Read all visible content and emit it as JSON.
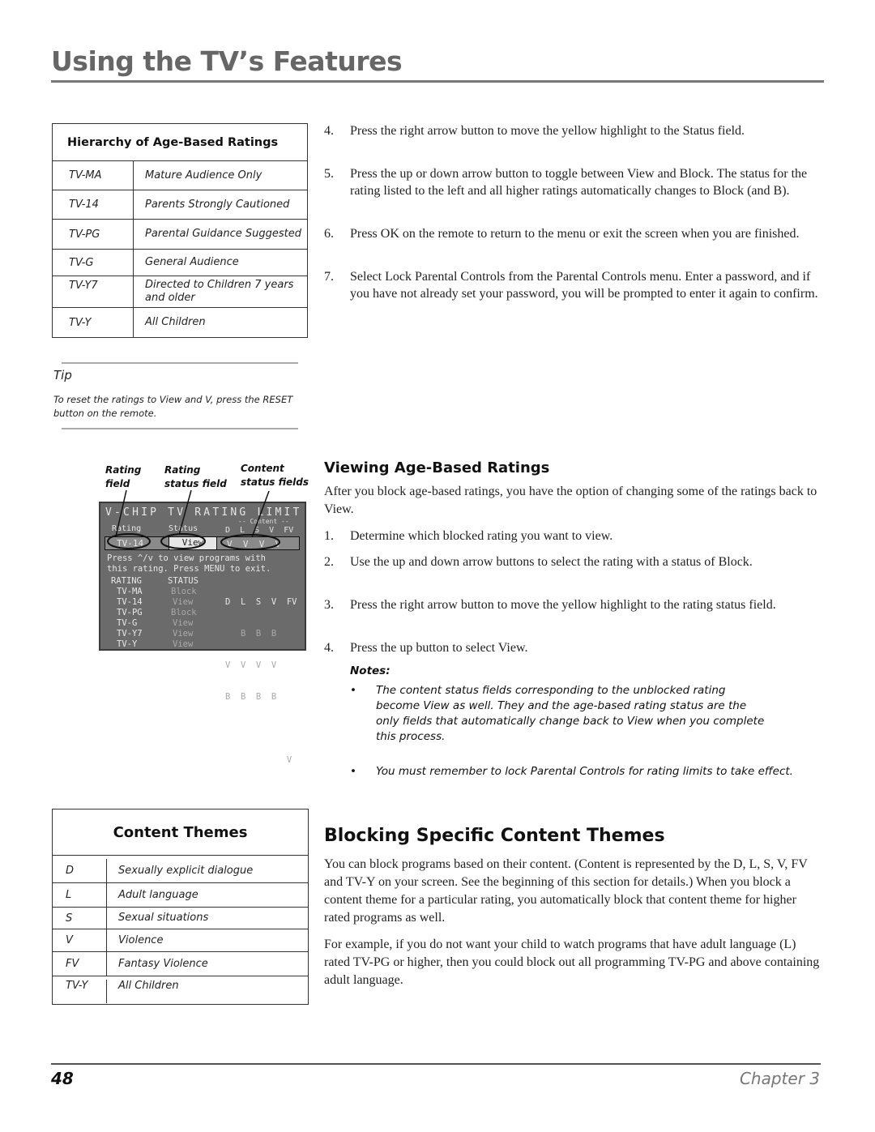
{
  "header": {
    "title": "Using the TV’s Features"
  },
  "ratings_table": {
    "title": "Hierarchy of Age-Based Ratings",
    "rows": [
      {
        "code": "TV-MA",
        "desc": "Mature Audience Only"
      },
      {
        "code": "TV-14",
        "desc": "Parents Strongly Cautioned"
      },
      {
        "code": "TV-PG",
        "desc": "Parental Guidance Suggested"
      },
      {
        "code": "TV-G",
        "desc": "General Audience"
      },
      {
        "code": "TV-Y7",
        "desc": "Directed to Children 7 years and older"
      },
      {
        "code": "TV-Y",
        "desc": "All Children"
      }
    ]
  },
  "tip": {
    "label": "Tip",
    "text": "To reset the ratings to View and V, press the RESET button on the remote."
  },
  "diagram": {
    "callouts": {
      "rating_field": "Rating field",
      "rating_status_field": "Rating status field",
      "content_status_fields": "Content status fields"
    },
    "screen": {
      "title": "V-CHIP TV RATING LIMIT",
      "content_label": "-- Content --",
      "col_rating": "Rating",
      "col_status": "Status",
      "content_cols": "D  L  S  V  FV",
      "selected_rating": "TV-14",
      "selected_status": "View",
      "selected_content": "V  V  V  V",
      "help_line1": "Press ^/v to view programs with",
      "help_line2": "this rating. Press MENU to exit.",
      "list_header": {
        "rating": "RATING",
        "status": "STATUS",
        "content": "D  L  S  V  FV"
      },
      "list_rows": [
        {
          "rating": "TV-MA",
          "status": "Block",
          "content": "   B  B  B"
        },
        {
          "rating": "TV-14",
          "status": "View",
          "content": "V  V  V  V"
        },
        {
          "rating": "TV-PG",
          "status": "Block",
          "content": "B  B  B  B"
        },
        {
          "rating": "TV-G",
          "status": "View",
          "content": ""
        },
        {
          "rating": "TV-Y7",
          "status": "View",
          "content": "            V"
        },
        {
          "rating": "TV-Y",
          "status": "View",
          "content": ""
        }
      ]
    }
  },
  "steps_top": [
    {
      "num": "4.",
      "text": "Press the right arrow button to move the yellow highlight to the Status field."
    },
    {
      "num": "5.",
      "text": "Press the up or down arrow button to toggle between View and Block. The status for the rating listed to the left and all higher ratings automatically changes to Block (and B)."
    },
    {
      "num": "6.",
      "text": "Press OK on the remote to return to the menu or exit the screen when you are finished."
    },
    {
      "num": "7.",
      "text": "Select Lock Parental Controls from the Parental Controls menu. Enter a password, and if you have not already set your password, you will be prompted to enter it again to confirm."
    }
  ],
  "viewing": {
    "heading": "Viewing Age-Based Ratings",
    "intro": "After you block age-based ratings, you have the option of changing some of the ratings back to View.",
    "steps": [
      {
        "num": "1.",
        "text": "Determine which blocked rating you want to view."
      },
      {
        "num": "2.",
        "text": "Use the up and down arrow buttons to select the rating with a status of Block."
      },
      {
        "num": "3.",
        "text": "Press the right arrow button to move the yellow highlight to the rating status field."
      },
      {
        "num": "4.",
        "text": "Press the up button to select View."
      }
    ],
    "notes_label": "Notes:",
    "notes": [
      "The content status fields corresponding to the unblocked rating become View as well. They and the age-based rating status are the only fields that automatically change back to View when you complete this process.",
      "You must remember to lock Parental Controls for rating limits to take effect."
    ]
  },
  "themes_table": {
    "title": "Content Themes",
    "rows": [
      {
        "code": "D",
        "desc": "Sexually explicit dialogue"
      },
      {
        "code": "L",
        "desc": "Adult language"
      },
      {
        "code": "S",
        "desc": "Sexual situations"
      },
      {
        "code": "V",
        "desc": "Violence"
      },
      {
        "code": "FV",
        "desc": "Fantasy Violence"
      },
      {
        "code": "TV-Y",
        "desc": "All Children"
      }
    ]
  },
  "blocking": {
    "heading": "Blocking Specific Content Themes",
    "para1": "You can block programs based on their content. (Content is represented by the D, L, S, V, FV and TV-Y on your screen. See the beginning of this section for details.) When you block a content theme for a particular rating, you automatically block that content theme for higher rated programs as well.",
    "para2": "For example, if you do not want your child to watch programs that have adult language (L) rated TV-PG or higher, then you could block out all programming TV-PG and above containing adult language."
  },
  "footer": {
    "page_number": "48",
    "chapter": "Chapter 3"
  }
}
